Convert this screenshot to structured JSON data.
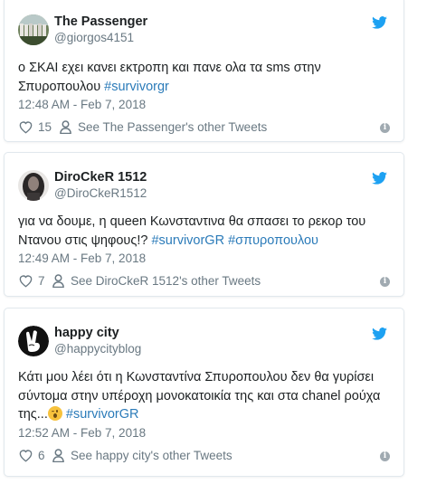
{
  "tweets": [
    {
      "name": "The Passenger",
      "handle": "@giorgos4151",
      "text": "ο ΣΚΑΙ εχει κανει εκτροπη και πανε ολα τα sms στην Σπυροπουλου ",
      "hashtags": [
        "#survivorgr"
      ],
      "time": "12:48 AM - Feb 7, 2018",
      "likes": "15",
      "other": "See The Passenger's other Tweets",
      "avatar_icon": "group-photo-avatar"
    },
    {
      "name": "DiroCkeR 1512",
      "handle": "@DiroCkeR1512",
      "text": "για να δουμε, η queen Κωνσταντινα θα σπασει το ρεκορ του Ντανου στις ψηφους!? ",
      "hashtags": [
        "#survivorGR",
        "#σπυροπουλου"
      ],
      "time": "12:49 AM - Feb 7, 2018",
      "likes": "7",
      "other": "See DiroCkeR 1512's other Tweets",
      "avatar_icon": "portrait-avatar"
    },
    {
      "name": "happy city",
      "handle": "@happycityblog",
      "text_line1": "Κάτι μου λέει ότι η Κωνσταντίνα Σπυροπουλου δεν θα γυρίσει",
      "text_line2": "σύντομα στην υπέροχη μονοκατοικία της και στα chanel ρούχα",
      "text_line3": "της...",
      "hashtags": [
        "#survivorGR"
      ],
      "time": "12:52 AM - Feb 7, 2018",
      "likes": "6",
      "other": "See happy city's other Tweets",
      "avatar_icon": "peace-hand-avatar",
      "emoji": "winking-face-emoji"
    }
  ],
  "colors": {
    "link": "#2b7bb9",
    "twitter_blue": "#1da1f2",
    "muted": "#697882",
    "border": "#e1e8ed"
  }
}
